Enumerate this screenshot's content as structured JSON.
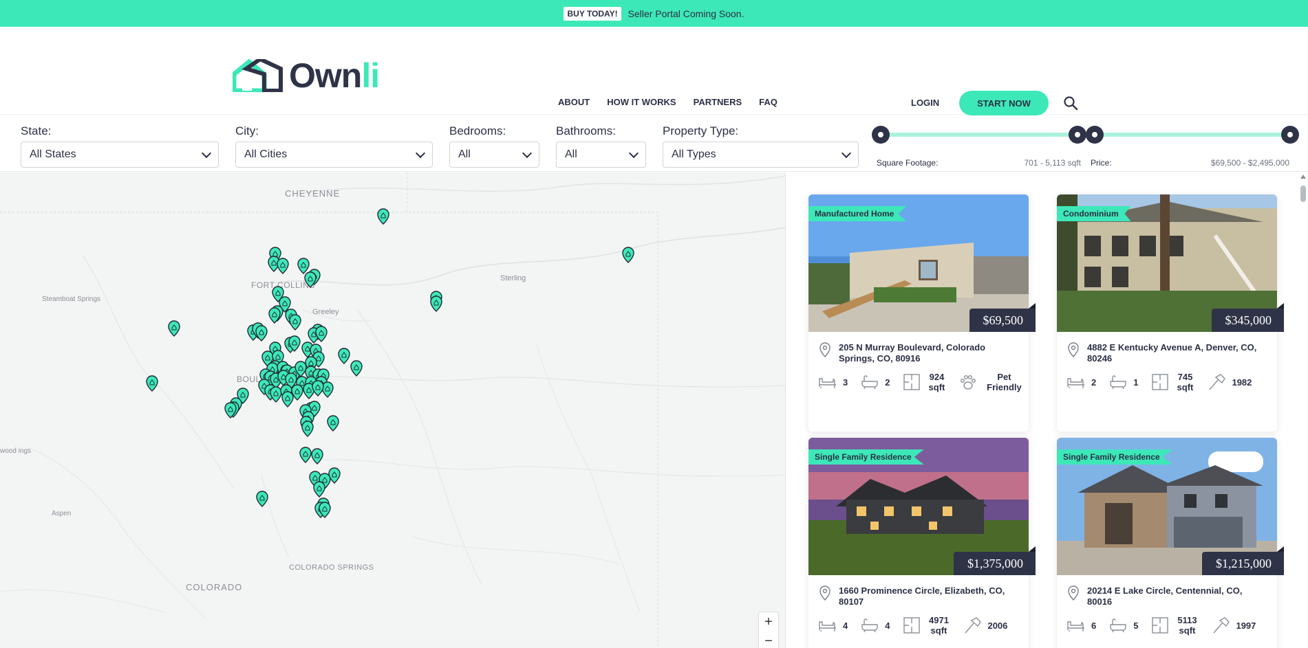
{
  "announcement": {
    "tag": "BUY TODAY!",
    "text": "Seller Portal Coming Soon."
  },
  "brand": {
    "name_a": "Own",
    "name_b": "li",
    "accent": "#3de8b8",
    "dark": "#2f3347"
  },
  "nav": {
    "items": [
      "ABOUT",
      "HOW IT WORKS",
      "PARTNERS",
      "FAQ"
    ],
    "login": "LOGIN",
    "cta": "START NOW"
  },
  "filters": {
    "state": {
      "label": "State:",
      "value": "All States"
    },
    "city": {
      "label": "City:",
      "value": "All Cities"
    },
    "bedrooms": {
      "label": "Bedrooms:",
      "value": "All"
    },
    "bathrooms": {
      "label": "Bathrooms:",
      "value": "All"
    },
    "property_type": {
      "label": "Property Type:",
      "value": "All Types"
    },
    "sqft": {
      "label": "Square Footage:",
      "range": "701 - 5,113 sqft"
    },
    "price": {
      "label": "Price:",
      "range": "$69,500 - $2,495,000"
    }
  },
  "map": {
    "labels": [
      "CHEYENNE",
      "FORT COLLINS",
      "Greeley",
      "Sterling",
      "Steamboat Springs",
      "BOULDER",
      "Aspen",
      "COLORADO SPRINGS",
      "COLORADO",
      "wood ings"
    ],
    "zoom_in": "+",
    "zoom_out": "−"
  },
  "listings": [
    {
      "type": "Manufactured Home",
      "price": "$69,500",
      "address": "205 N Murray Boulevard, Colorado Springs, CO, 80916",
      "beds": "3",
      "baths": "2",
      "sqft": "924 sqft",
      "extra_icon": "paw-icon",
      "extra": "Pet Friendly"
    },
    {
      "type": "Condominium",
      "price": "$345,000",
      "address": "4882 E Kentucky Avenue A, Denver, CO, 80246",
      "beds": "2",
      "baths": "1",
      "sqft": "745 sqft",
      "extra_icon": "hammer-icon",
      "extra": "1982"
    },
    {
      "type": "Single Family Residence",
      "price": "$1,375,000",
      "address": "1660 Prominence Circle, Elizabeth, CO, 80107",
      "beds": "4",
      "baths": "4",
      "sqft": "4971 sqft",
      "extra_icon": "hammer-icon",
      "extra": "2006"
    },
    {
      "type": "Single Family Residence",
      "price": "$1,215,000",
      "address": "20214 E Lake Circle, Centennial, CO, 80016",
      "beds": "6",
      "baths": "5",
      "sqft": "5113 sqft",
      "extra_icon": "hammer-icon",
      "extra": "1997"
    }
  ]
}
